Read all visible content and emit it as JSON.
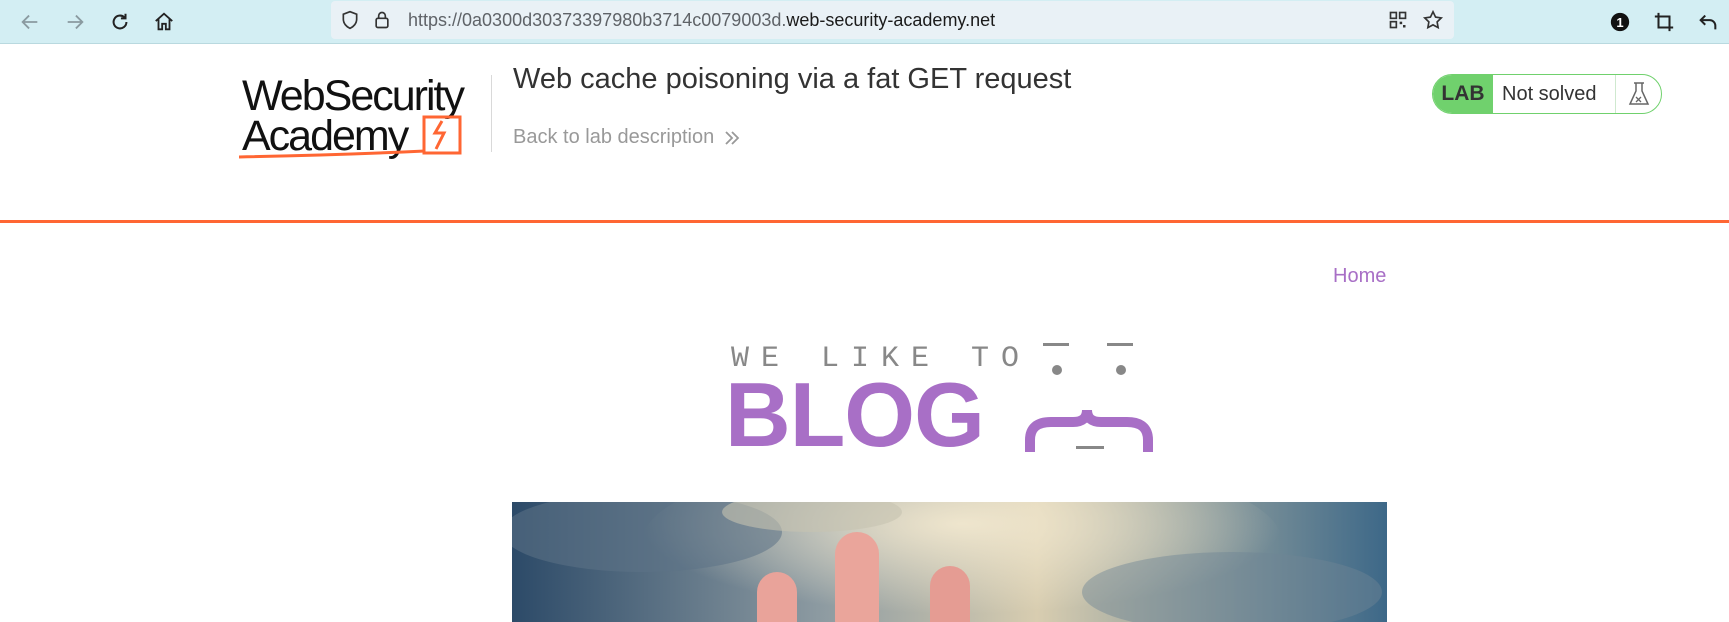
{
  "browser": {
    "url_prefix": "https://0a0300d30373397980b3714c0079003d.",
    "url_host": "web-security-academy.net",
    "notification_count": "1"
  },
  "lab": {
    "logo_line1": "WebSecurity",
    "logo_line2": "Academy",
    "title": "Web cache poisoning via a fat GET request",
    "back_link": "Back to lab description",
    "badge": "LAB",
    "status": "Not solved",
    "accent_color": "#ff6633",
    "status_color": "#70d16d"
  },
  "blog": {
    "nav_home": "Home",
    "tagline": "WE LIKE TO",
    "word": "BLOG",
    "brand_color": "#a86fc6"
  },
  "icons": [
    "back-arrow-icon",
    "forward-arrow-icon",
    "reload-icon",
    "home-icon",
    "shield-icon",
    "lock-icon",
    "qr-code-icon",
    "star-icon",
    "extension-badge-icon",
    "crop-icon",
    "undo-icon",
    "double-chevron-icon",
    "flask-icon"
  ]
}
